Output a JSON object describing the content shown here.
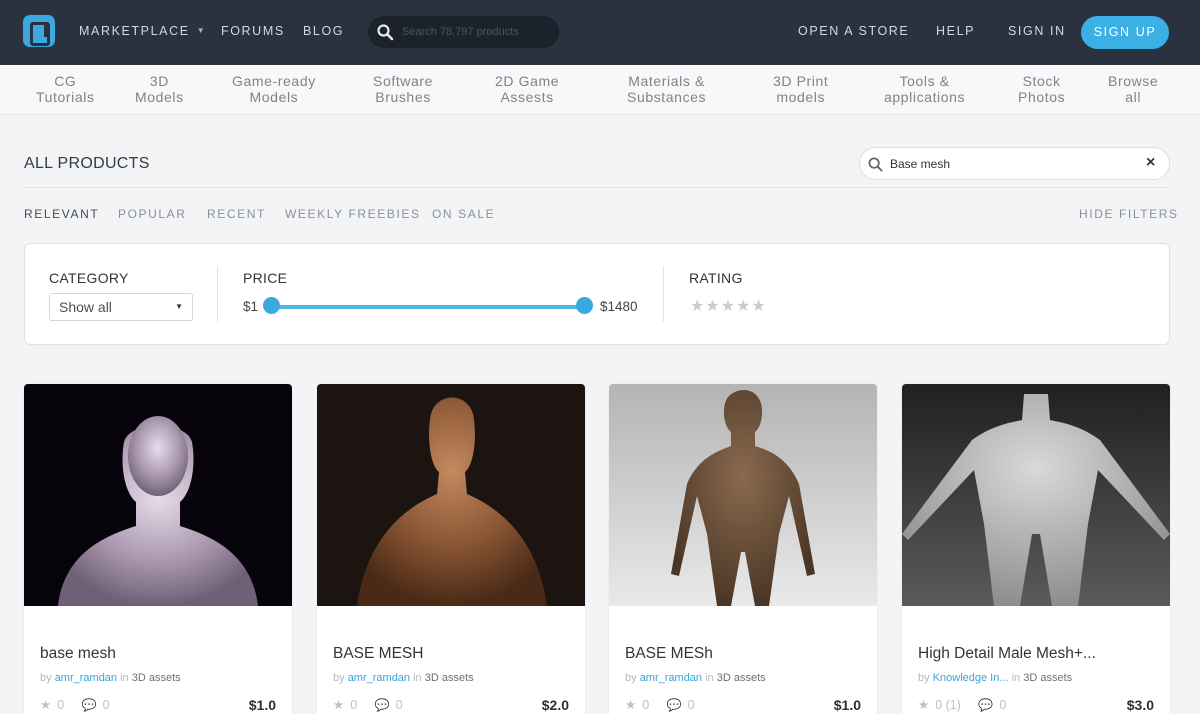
{
  "nav": {
    "marketplace": "MARKETPLACE",
    "forums": "FORUMS",
    "blog": "BLOG",
    "search_placeholder": "Search 78,797 products",
    "open_store": "OPEN A STORE",
    "help": "HELP",
    "sign_in": "SIGN IN",
    "sign_up": "SIGN UP"
  },
  "categories": [
    {
      "line1": "CG",
      "line2": "Tutorials"
    },
    {
      "line1": "3D",
      "line2": "Models"
    },
    {
      "line1": "Game-ready",
      "line2": "Models"
    },
    {
      "line1": "Software",
      "line2": "Brushes"
    },
    {
      "line1": "2D Game",
      "line2": "Assests"
    },
    {
      "line1": "Materials &",
      "line2": "Substances"
    },
    {
      "line1": "3D Print",
      "line2": "models"
    },
    {
      "line1": "Tools &",
      "line2": "applications"
    },
    {
      "line1": "Stock",
      "line2": "Photos"
    },
    {
      "line1": "Browse",
      "line2": "all"
    }
  ],
  "page": {
    "title": "ALL PRODUCTS",
    "search_value": "Base mesh",
    "clear": "×"
  },
  "sort": {
    "relevant": "RELEVANT",
    "popular": "POPULAR",
    "recent": "RECENT",
    "weekly_freebies": "WEEKLY FREEBIES",
    "on_sale": "ON SALE",
    "hide_filters": "HIDE FILTERS",
    "active": "relevant"
  },
  "filters": {
    "category_label": "CATEGORY",
    "category_value": "Show all",
    "price_label": "PRICE",
    "price_min": "$1",
    "price_max": "$1480",
    "price_range_fraction": [
      0.0,
      1.0
    ],
    "rating_label": "RATING",
    "rating_stars": "★★★★★"
  },
  "products": [
    {
      "title": "base mesh",
      "by": "by",
      "author": "amr_ramdan",
      "in": "in",
      "category": "3D assets",
      "rating": "0",
      "comments": "0",
      "price": "$1.0"
    },
    {
      "title": "BASE MESH",
      "by": "by",
      "author": "amr_ramdan",
      "in": "in",
      "category": "3D assets",
      "rating": "0",
      "comments": "0",
      "price": "$2.0"
    },
    {
      "title": "BASE MESh",
      "by": "by",
      "author": "amr_ramdan",
      "in": "in",
      "category": "3D assets",
      "rating": "0",
      "comments": "0",
      "price": "$1.0"
    },
    {
      "title": "High Detail Male Mesh+...",
      "by": "by",
      "author": "Knowledge In...",
      "in": "in",
      "category": "3D assets",
      "rating": "0 (1)",
      "comments": "0",
      "price": "$3.0"
    }
  ],
  "colors": {
    "topbar": "#2a3240",
    "accent": "#3bb0e4",
    "link": "#3aa3d8"
  }
}
